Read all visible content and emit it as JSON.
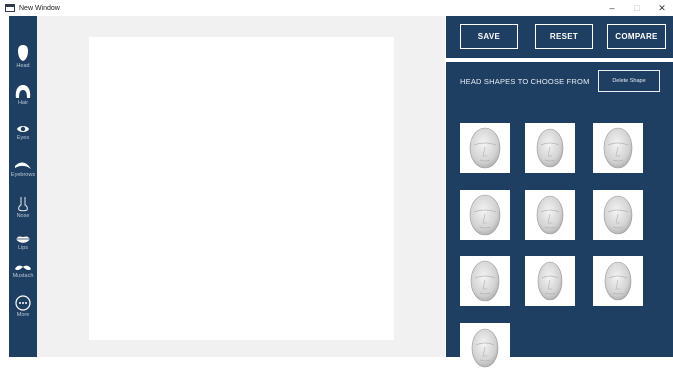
{
  "window": {
    "title": "New Window",
    "controls": {
      "minimize": "–",
      "maximize": "□",
      "close": "✕"
    }
  },
  "toolbar": {
    "items": [
      {
        "label": "Head",
        "icon": "head-icon"
      },
      {
        "label": "Hair",
        "icon": "hair-icon"
      },
      {
        "label": "Eyes",
        "icon": "eye-icon"
      },
      {
        "label": "Eyebrows",
        "icon": "eyebrow-icon"
      },
      {
        "label": "Nose",
        "icon": "nose-icon"
      },
      {
        "label": "Lips",
        "icon": "lips-icon"
      },
      {
        "label": "Mustach",
        "icon": "mustache-icon"
      },
      {
        "label": "More",
        "icon": "more-icon"
      }
    ]
  },
  "actions": {
    "save": "SAVE",
    "reset": "RESET",
    "compare": "COMPARE"
  },
  "shapes_panel": {
    "title": "HEAD SHAPES TO CHOOSE FROM",
    "delete_label": "Delete Shape",
    "thumbnail_count": 10
  },
  "colors": {
    "panel": "#1e3f61",
    "workspace": "#f1f1f1",
    "canvas": "#ffffff"
  }
}
